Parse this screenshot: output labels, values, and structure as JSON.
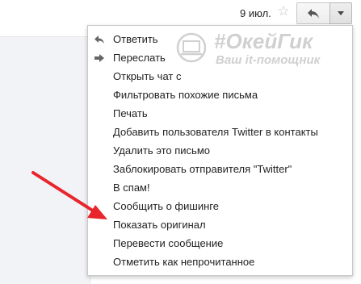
{
  "header": {
    "date": "9 июл.",
    "icons": {
      "star": "star-icon",
      "reply": "reply-arrow-icon",
      "more": "caret-down-icon"
    }
  },
  "menu": {
    "items": [
      {
        "label": "Ответить",
        "icon": "reply-icon"
      },
      {
        "label": "Переслать",
        "icon": "forward-icon"
      },
      {
        "label": "Открыть чат с"
      },
      {
        "label": "Фильтровать похожие письма"
      },
      {
        "label": "Печать"
      },
      {
        "label": "Добавить пользователя Twitter в контакты"
      },
      {
        "label": "Удалить это письмо"
      },
      {
        "label": "Заблокировать отправителя \"Twitter\""
      },
      {
        "label": "В спам!"
      },
      {
        "label": "Сообщить о фишинге"
      },
      {
        "label": "Показать оригинал"
      },
      {
        "label": "Перевести сообщение"
      },
      {
        "label": "Отметить как непрочитанное"
      }
    ]
  },
  "watermark": {
    "title": "#ОкейГик",
    "subtitle": "Ваш it-помощник"
  },
  "colors": {
    "arrow": "#e8252c",
    "menu_text": "#222222",
    "grey_bg": "#f1f3f6"
  }
}
